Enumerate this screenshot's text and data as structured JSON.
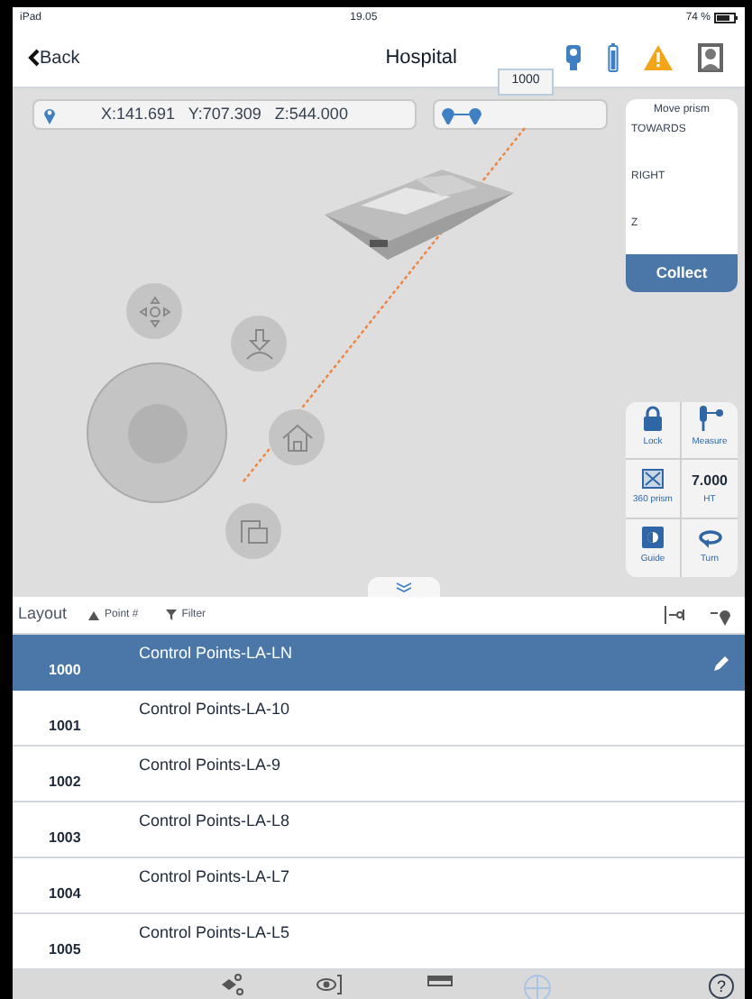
{
  "status_bar": {
    "device": "iPad",
    "time": "19.05",
    "battery": "74 %"
  },
  "nav": {
    "back": "Back",
    "title": "Hospital",
    "warning": true
  },
  "coordinates": "X:141.691   Y:707.309   Z:544.000",
  "tooltip": "1000",
  "move_prism": {
    "title": "Move prism",
    "lines": [
      "TOWARDS",
      "RIGHT",
      "Z"
    ],
    "button": "Collect"
  },
  "tools": [
    {
      "kind": "lock",
      "label": "Lock"
    },
    {
      "kind": "prism",
      "label": "360 prism"
    },
    {
      "kind": "guide",
      "label": "Guide"
    },
    {
      "kind": "measure",
      "label": "Measure"
    },
    {
      "kind": "value",
      "value": "7.000",
      "label": "HT"
    },
    {
      "kind": "turn",
      "label": "Turn"
    }
  ],
  "list_header": {
    "title": "Layout",
    "sort": "Point #",
    "filter": "Filter"
  },
  "rows": [
    {
      "number": "1000",
      "name": "Control Points-LA-LN",
      "selected": true
    },
    {
      "number": "1001",
      "name": "Control Points-LA-10",
      "selected": false
    },
    {
      "number": "1002",
      "name": "Control Points-LA-9",
      "selected": false
    },
    {
      "number": "1003",
      "name": "Control Points-LA-L8",
      "selected": false
    },
    {
      "number": "1004",
      "name": "Control Points-LA-L7",
      "selected": false
    },
    {
      "number": "1005",
      "name": "Control Points-LA-L5",
      "selected": false
    }
  ],
  "bottom_bar": [
    {
      "kind": "points",
      "selected": false
    },
    {
      "kind": "eye",
      "selected": false
    },
    {
      "kind": "ruler",
      "selected": false
    },
    {
      "kind": "crosshair",
      "selected": true
    }
  ],
  "help": "?"
}
